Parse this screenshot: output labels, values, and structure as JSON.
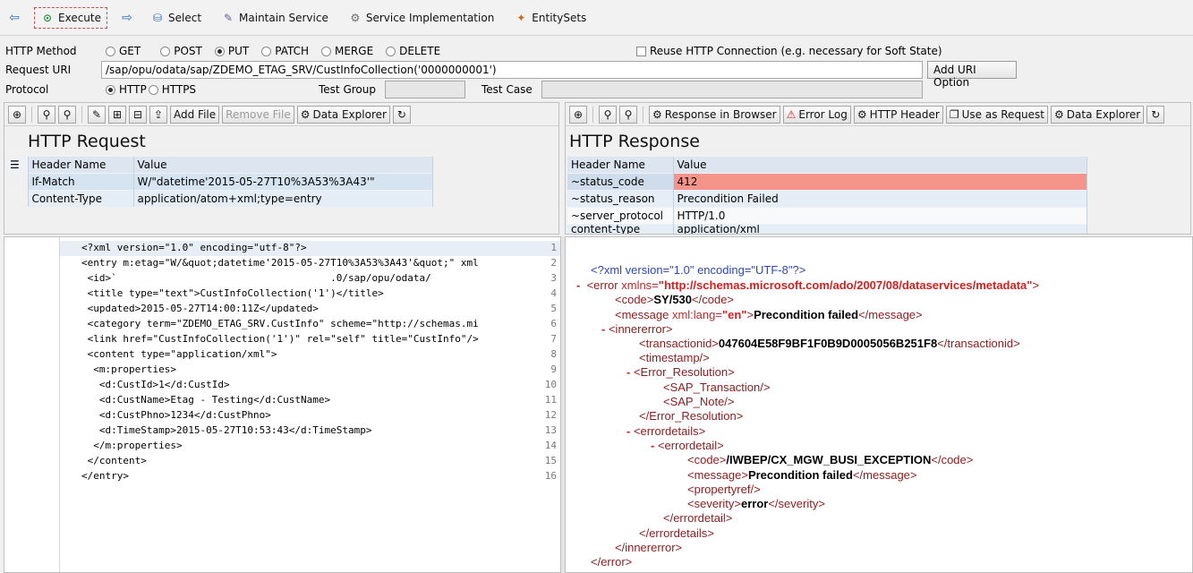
{
  "toolbar": {
    "execute": "Execute",
    "select": "Select",
    "maintain_service": "Maintain Service",
    "service_impl": "Service Implementation",
    "entity_sets": "EntitySets"
  },
  "form": {
    "http_method_label": "HTTP Method",
    "methods": [
      "GET",
      "POST",
      "PUT",
      "PATCH",
      "MERGE",
      "DELETE"
    ],
    "selected_method": "PUT",
    "reuse_label": "Reuse HTTP Connection (e.g. necessary for Soft State)",
    "request_uri_label": "Request URI",
    "request_uri": "/sap/opu/odata/sap/ZDEMO_ETAG_SRV/CustInfoCollection('0000000001')",
    "add_uri_option": "Add URI Option",
    "protocol_label": "Protocol",
    "protocols": [
      "HTTP",
      "HTTPS"
    ],
    "test_group_label": "Test Group",
    "test_case_label": "Test Case"
  },
  "request_panel": {
    "add_file": "Add File",
    "remove_file": "Remove File",
    "data_explorer": "Data Explorer",
    "title": "HTTP Request",
    "col_header": "Header Name",
    "col_value": "Value",
    "rows": [
      {
        "name": "If-Match",
        "value": "W/\"datetime'2015-05-27T10%3A53%3A43'\""
      },
      {
        "name": "Content-Type",
        "value": "application/atom+xml;type=entry"
      }
    ]
  },
  "response_panel": {
    "response_in_browser": "Response in Browser",
    "error_log": "Error Log",
    "http_header": "HTTP Header",
    "use_as_request": "Use as Request",
    "data_explorer": "Data Explorer",
    "title": "HTTP Response",
    "col_header": "Header Name",
    "col_value": "Value",
    "rows": [
      {
        "name": "~status_code",
        "value": "412"
      },
      {
        "name": "~status_reason",
        "value": "Precondition Failed"
      },
      {
        "name": "~server_protocol",
        "value": "HTTP/1.0"
      },
      {
        "name": "content-type",
        "value": "application/xml"
      }
    ]
  },
  "request_body": {
    "line_numbers": [
      "1",
      "2",
      "3",
      "4",
      "5",
      "6",
      "7",
      "8",
      "9",
      "10",
      "11",
      "12",
      "13",
      "14",
      "15",
      "16"
    ],
    "lines": [
      "<?xml version=\"1.0\" encoding=\"utf-8\"?>",
      "<entry m:etag=\"W/&quot;datetime'2015-05-27T10%3A53%3A43'&quot;\" xml",
      " <id>`                                    .0/sap/opu/odata/",
      " <title type=\"text\">CustInfoCollection('1')</title>",
      " <updated>2015-05-27T14:00:11Z</updated>",
      " <category term=\"ZDEMO_ETAG_SRV.CustInfo\" scheme=\"http://schemas.mi",
      " <link href=\"CustInfoCollection('1')\" rel=\"self\" title=\"CustInfo\"/>",
      " <content type=\"application/xml\">",
      "  <m:properties>",
      "   <d:CustId>1</d:CustId>",
      "   <d:CustName>Etag - Testing</d:CustName>",
      "   <d:CustPhno>1234</d:CustPhno>",
      "   <d:TimeStamp>2015-05-27T10:53:43</d:TimeStamp>",
      "  </m:properties>",
      " </content>",
      "</entry>"
    ]
  },
  "response_body": {
    "xml_decl": "<?xml version=\"1.0\" encoding=\"UTF-8\"?>",
    "ns_url": "http://schemas.microsoft.com/ado/2007/08/dataservices/metadata",
    "code": "SY/530",
    "message": "Precondition failed",
    "lang": "en",
    "transactionid": "047604E58F9BF1F0B9D0005056B251F8",
    "err_code": "/IWBEP/CX_MGW_BUSI_EXCEPTION",
    "err_message": "Precondition failed",
    "severity": "error"
  },
  "colors": {
    "error_cell": "#f5948b",
    "header_bg": "#dde6f0",
    "tag": "#8b1c1c"
  }
}
